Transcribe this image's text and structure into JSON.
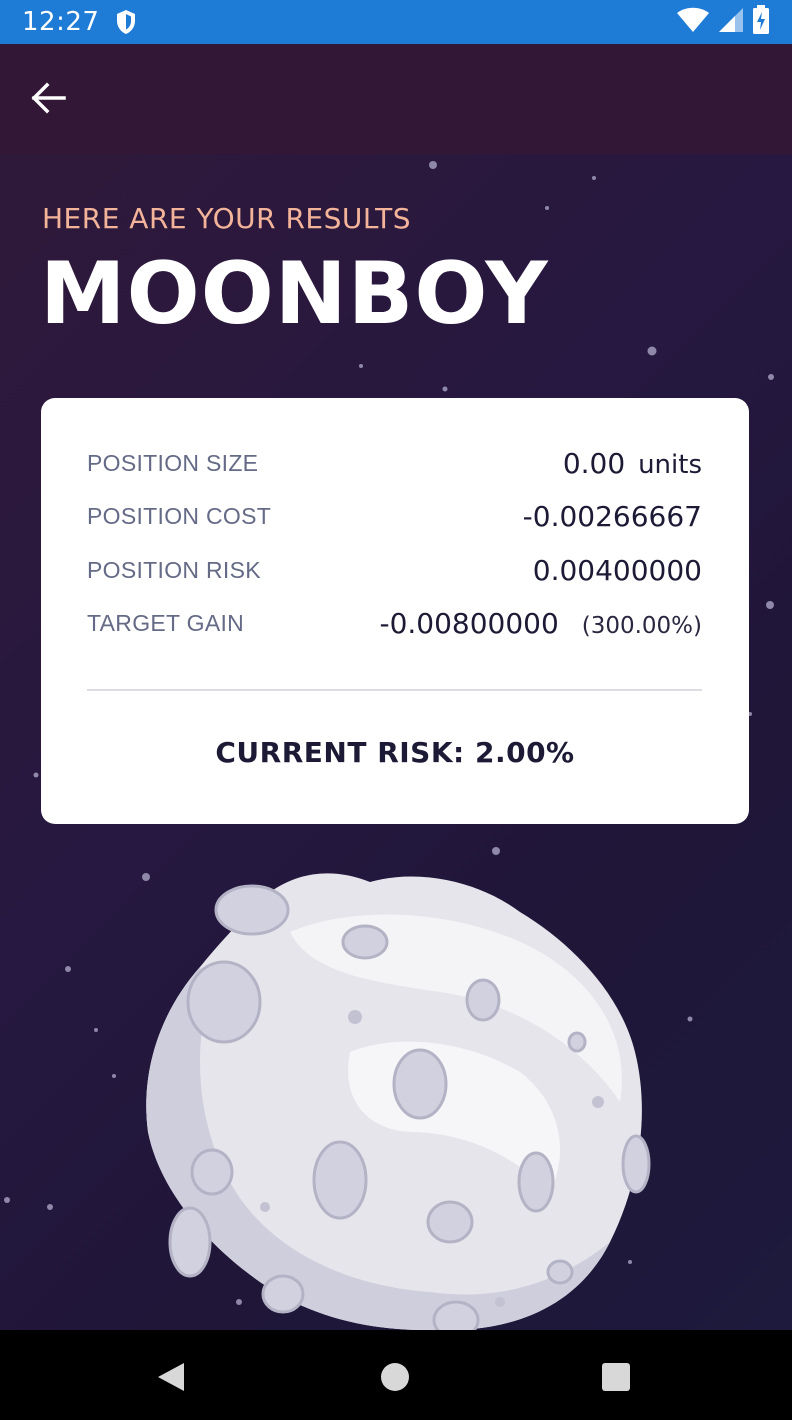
{
  "status_bar": {
    "time": "12:27",
    "icons": [
      "shield-icon",
      "wifi-icon",
      "signal-icon",
      "battery-icon"
    ]
  },
  "toolbar": {
    "back_icon": "arrow-back-icon"
  },
  "header": {
    "subtitle": "HERE ARE YOUR RESULTS",
    "title": "MOONBOY"
  },
  "results": {
    "rows": [
      {
        "label": "POSITION SIZE",
        "value": "0.00",
        "unit": "units"
      },
      {
        "label": "POSITION COST",
        "value": "-0.00266667"
      },
      {
        "label": "POSITION RISK",
        "value": "0.00400000"
      },
      {
        "label": "TARGET GAIN",
        "value": "-0.00800000",
        "percent": "(300.00%)"
      }
    ],
    "current_risk": "CURRENT RISK: 2.00%"
  },
  "illustration": "moon-illustration",
  "nav_bar": {
    "icons": [
      "back-triangle-icon",
      "home-circle-icon",
      "recents-square-icon"
    ]
  },
  "colors": {
    "status_bar": "#1e7bd6",
    "toolbar": "#331736",
    "background": "#261840",
    "subtitle": "#f4b49a",
    "card": "#ffffff",
    "text_dark": "#1c1a35",
    "text_muted": "#656a86"
  }
}
